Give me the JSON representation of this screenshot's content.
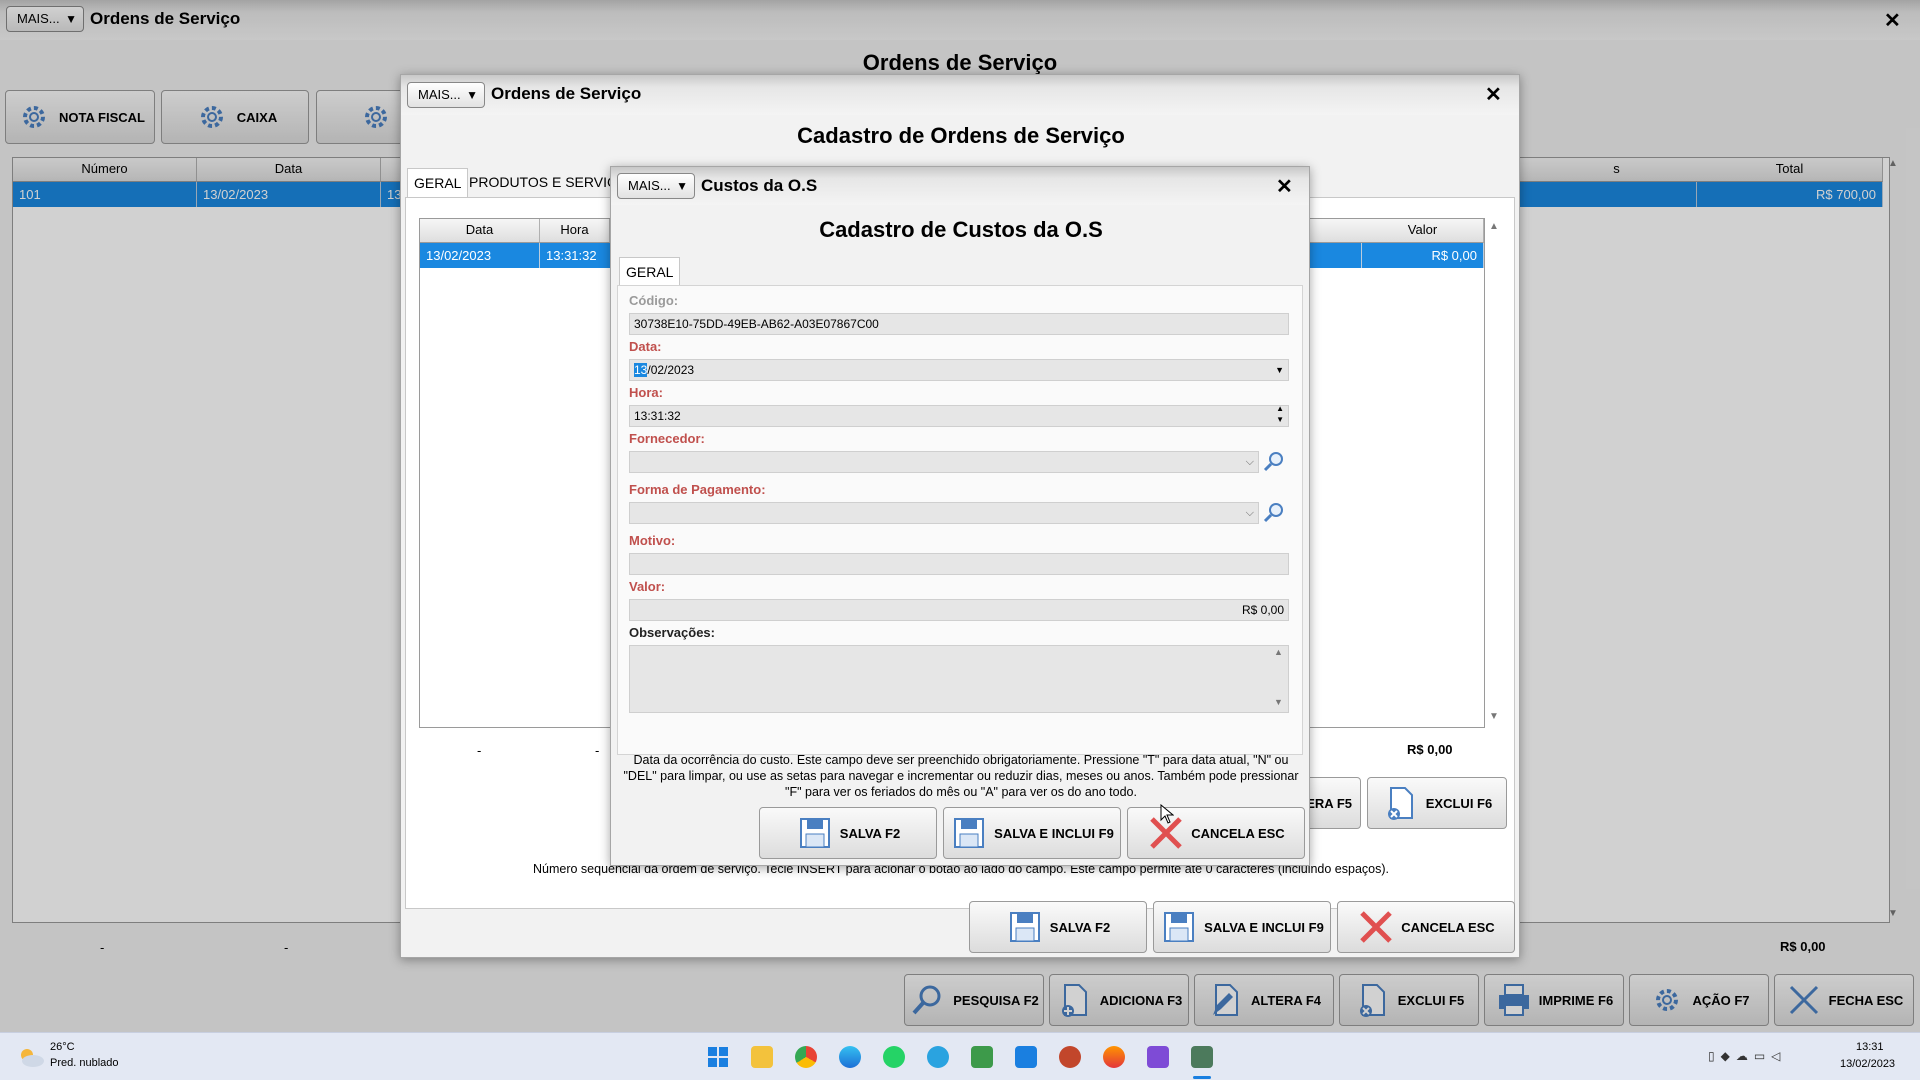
{
  "outer": {
    "mais": "MAIS...",
    "title": "Ordens de Serviço",
    "close": "✕",
    "heading": "Ordens de Serviço",
    "top_buttons": [
      "NOTA FISCAL",
      "CAIXA"
    ],
    "grid": {
      "columns": [
        "Número",
        "Data",
        "s",
        "Total"
      ],
      "row": {
        "numero": "101",
        "data": "13/02/2023",
        "partial": "13",
        "total": "R$ 700,00"
      },
      "footer": {
        "a": "-",
        "b": "-",
        "total": "R$ 0,00"
      }
    },
    "bottom_buttons": {
      "pesquisa": "PESQUISA F2",
      "adiciona": "ADICIONA F3",
      "altera": "ALTERA F4",
      "exclui": "EXCLUI F5",
      "imprime": "IMPRIME F6",
      "acao": "AÇÃO F7",
      "fecha": "FECHA ESC"
    }
  },
  "middle": {
    "mais": "MAIS...",
    "title": "Ordens de Serviço",
    "close": "✕",
    "heading": "Cadastro de Ordens de Serviço",
    "tabs": [
      "GERAL",
      "PRODUTOS E SERVIÇOS"
    ],
    "grid": {
      "columns": [
        "Data",
        "Hora",
        "Valor"
      ],
      "row": {
        "data": "13/02/2023",
        "hora": "13:31:32",
        "valor": "R$ 0,00"
      },
      "footer": {
        "a": "-",
        "b": "-",
        "total": "R$ 0,00"
      }
    },
    "partial_buttons": {
      "altera": "ERA F5",
      "exclui": "EXCLUI F6"
    },
    "hint": "Número sequencial da ordem de serviço. Tecle INSERT para acionar o botão ao lado do campo. Este campo permite até 0 caracteres (incluindo espaços).",
    "buttons": {
      "salva": "SALVA F2",
      "salva_inclui": "SALVA E INCLUI F9",
      "cancela": "CANCELA ESC"
    }
  },
  "inner": {
    "mais": "MAIS...",
    "title": "Custos da O.S",
    "close": "✕",
    "heading": "Cadastro de Custos da O.S",
    "tab": "GERAL",
    "fields": {
      "codigo_label": "Código:",
      "codigo_value": "30738E10-75DD-49EB-AB62-A03E07867C00",
      "data_label": "Data:",
      "data_sel": "13",
      "data_rest": "/02/2023",
      "hora_label": "Hora:",
      "hora_value": "13:31:32",
      "fornecedor_label": "Fornecedor:",
      "fornecedor_value": "",
      "forma_label": "Forma de Pagamento:",
      "forma_value": "",
      "motivo_label": "Motivo:",
      "motivo_value": "",
      "valor_label": "Valor:",
      "valor_value": "R$ 0,00",
      "obs_label": "Observações:",
      "obs_value": ""
    },
    "hint": "Data da ocorrência do custo. Este campo deve ser preenchido obrigatoriamente. Pressione \"T\" para data atual, \"N\" ou \"DEL\" para limpar, ou use as setas para navegar e incrementar ou reduzir dias, meses ou anos. Também pode pressionar \"F\" para ver os feriados do mês ou \"A\" para ver os do ano todo.",
    "buttons": {
      "salva": "SALVA F2",
      "salva_inclui": "SALVA E INCLUI F9",
      "cancela": "CANCELA ESC"
    }
  },
  "taskbar": {
    "weather_temp": "26°C",
    "weather_desc": "Pred. nublado",
    "time": "13:31",
    "date": "13/02/2023"
  }
}
